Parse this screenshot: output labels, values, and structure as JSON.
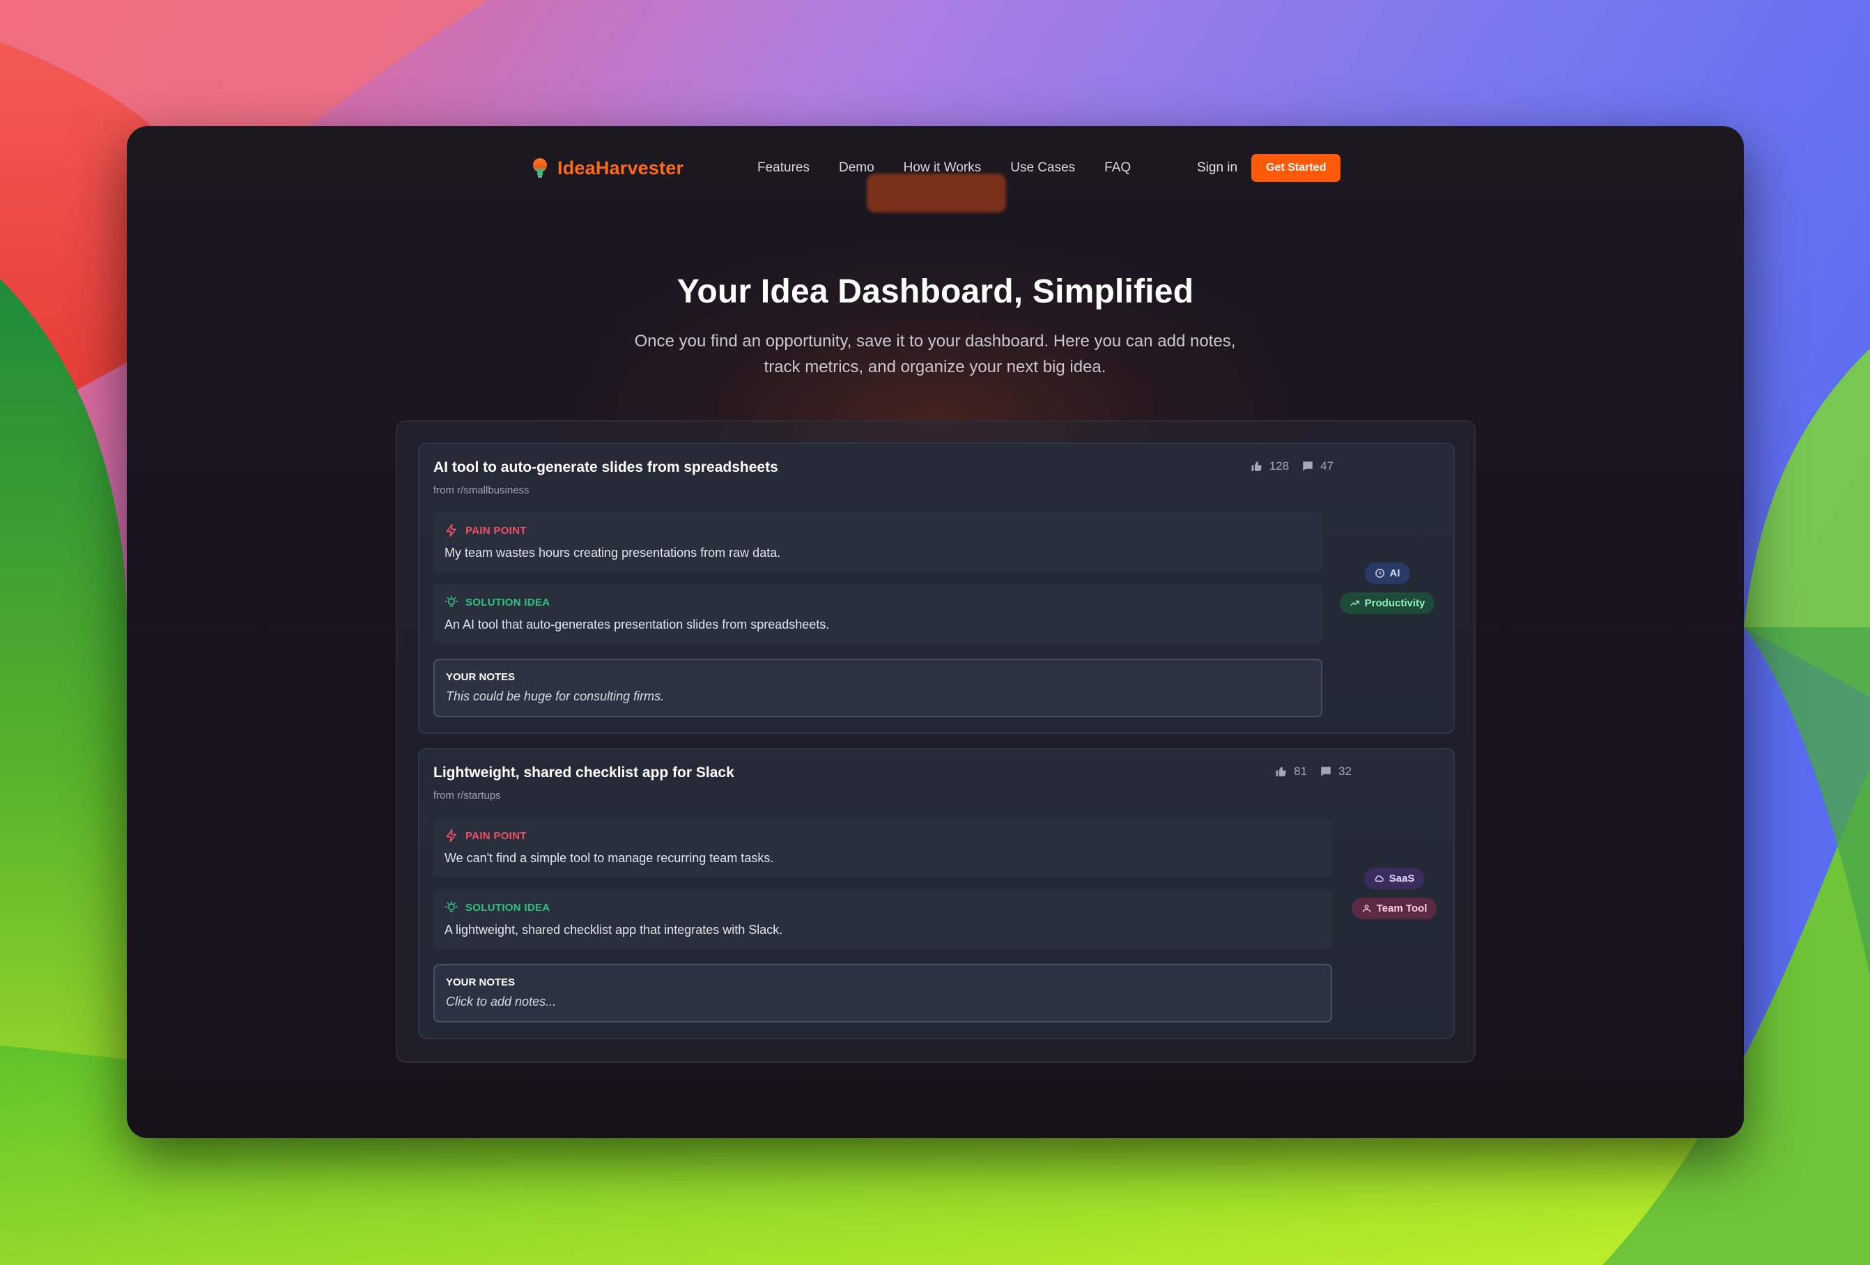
{
  "app": {
    "brand": "IdeaHarvester",
    "colors": {
      "accent": "#ff5a0a",
      "pain": "#f0506a",
      "solution": "#2ec27e"
    }
  },
  "nav": {
    "links": [
      "Features",
      "Demo",
      "How it Works",
      "Use Cases",
      "FAQ"
    ],
    "sign_in": "Sign in",
    "cta": "Get Started"
  },
  "hero": {
    "title": "Your Idea Dashboard, Simplified",
    "subtitle": "Once you find an opportunity, save it to your dashboard. Here you can add notes, track metrics, and organize your next big idea."
  },
  "ideas": [
    {
      "title": "AI tool to auto-generate slides from spreadsheets",
      "source": "from r/smallbusiness",
      "upvotes": "128",
      "comments": "47",
      "pain_label": "PAIN POINT",
      "pain_text": "My team wastes hours creating presentations from raw data.",
      "solution_label": "SOLUTION IDEA",
      "solution_text": "An AI tool that auto-generates presentation slides from spreadsheets.",
      "notes_label": "YOUR NOTES",
      "notes_text": "This could be huge for consulting firms.",
      "tags": [
        {
          "label": "AI",
          "icon": "clock-icon"
        },
        {
          "label": "Productivity",
          "icon": "trending-up-icon"
        }
      ]
    },
    {
      "title": "Lightweight, shared checklist app for Slack",
      "source": "from r/startups",
      "upvotes": "81",
      "comments": "32",
      "pain_label": "PAIN POINT",
      "pain_text": "We can't find a simple tool to manage recurring team tasks.",
      "solution_label": "SOLUTION IDEA",
      "solution_text": "A lightweight, shared checklist app that integrates with Slack.",
      "notes_label": "YOUR NOTES",
      "notes_text": "Click to add notes...",
      "tags": [
        {
          "label": "SaaS",
          "icon": "cloud-icon"
        },
        {
          "label": "Team Tool",
          "icon": "users-icon"
        }
      ]
    }
  ]
}
